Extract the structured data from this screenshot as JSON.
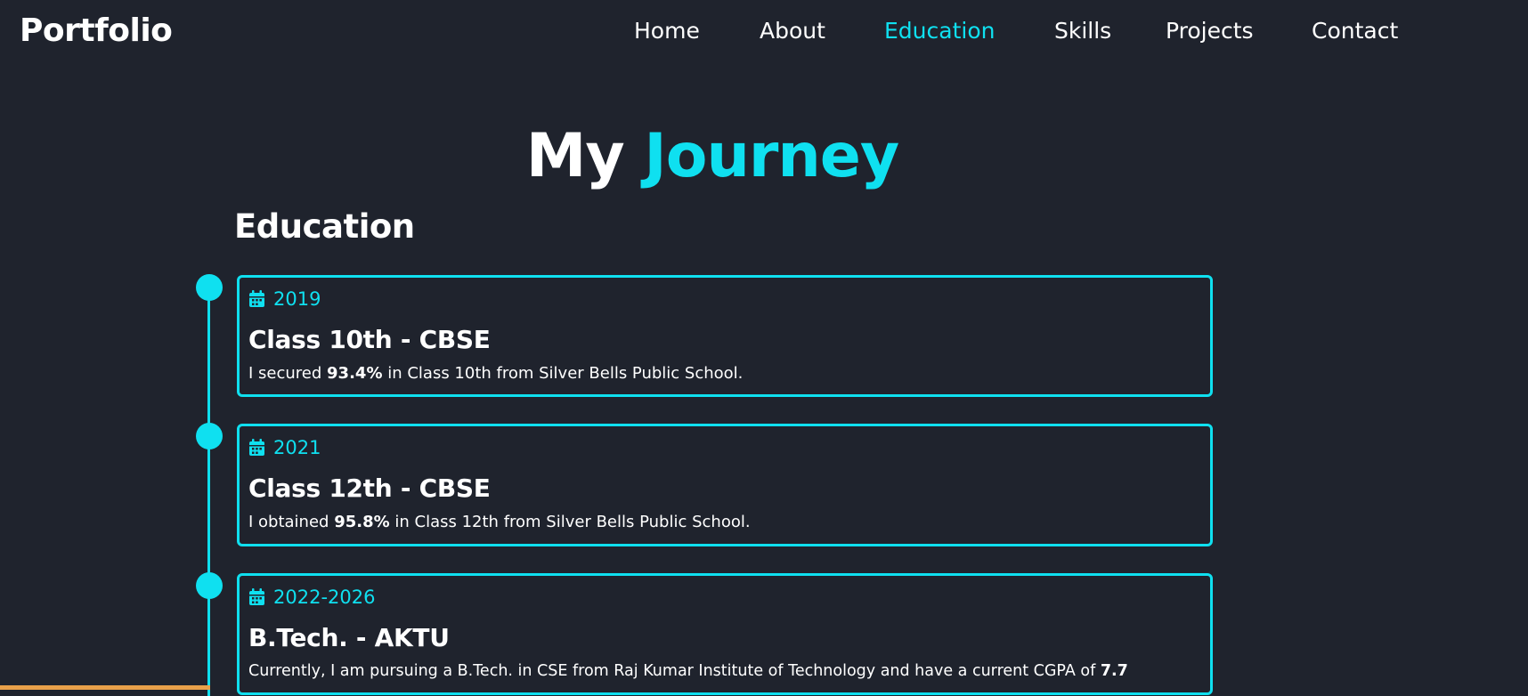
{
  "nav": {
    "logo": "Portfolio",
    "links": [
      {
        "label": "Home",
        "active": false
      },
      {
        "label": "About",
        "active": false
      },
      {
        "label": "Education",
        "active": true
      },
      {
        "label": "Skills",
        "active": false
      },
      {
        "label": "Projects",
        "active": false
      },
      {
        "label": "Contact",
        "active": false
      }
    ]
  },
  "heading": {
    "main_plain": "My",
    "main_accent": "Journey",
    "section": "Education"
  },
  "timeline": [
    {
      "date": "2019",
      "title": "Class 10th - CBSE",
      "desc_pre": "I secured",
      "desc_value": "93.4%",
      "desc_post": "in Class 10th from Silver Bells Public School."
    },
    {
      "date": "2021",
      "title": "Class 12th - CBSE",
      "desc_pre": "I obtained",
      "desc_value": "95.8%",
      "desc_post": "in Class 12th from Silver Bells Public School."
    },
    {
      "date": "2022-2026",
      "title": "B.Tech. - AKTU",
      "desc_pre": "Currently, I am pursuing a B.Tech. in CSE from Raj Kumar Institute of Technology and have a current CGPA of",
      "desc_value": "7.7",
      "desc_post": ""
    }
  ],
  "colors": {
    "background": "#1f232d",
    "accent": "#0fe0f0",
    "text": "#ffffff",
    "bottom_bar": "#e8a04a"
  },
  "icons": {
    "date": "calendar-icon"
  }
}
